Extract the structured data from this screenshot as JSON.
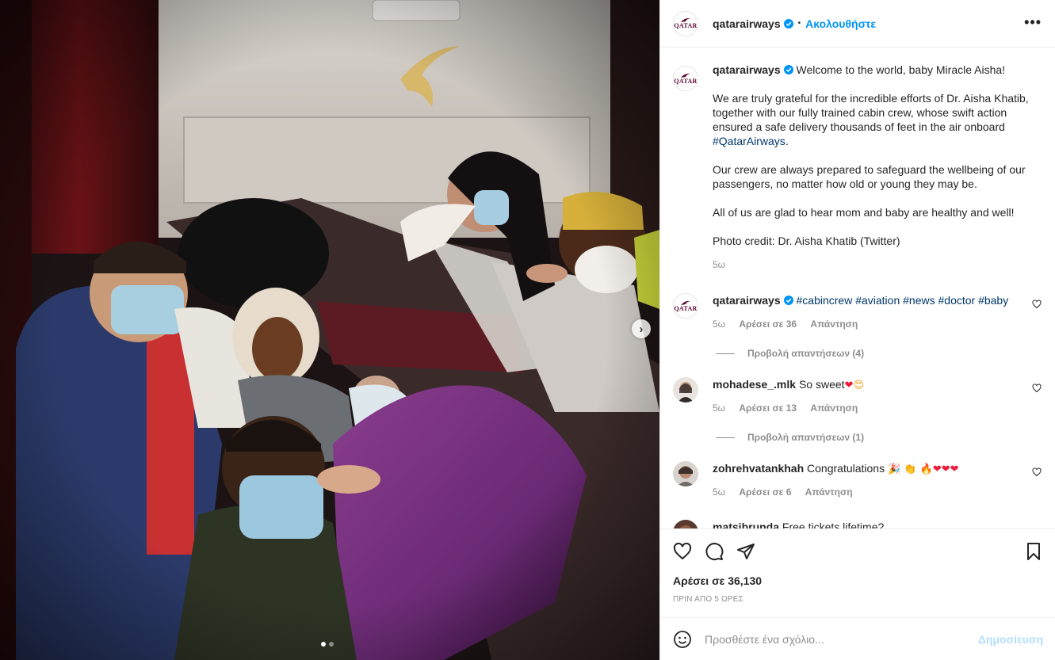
{
  "post": {
    "username": "qatarairways",
    "follow_label": "Ακολουθήστε",
    "dot_separator": "•",
    "more_label": "•••",
    "logo_text": "QATAR",
    "caption": {
      "intro": "Welcome to the world, baby Miracle Aisha!",
      "para1": "We are truly grateful for the incredible efforts of Dr. Aisha Khatib, together with our fully trained cabin crew, whose swift action ensured a safe delivery thousands of feet in the air onboard",
      "para1_tag": "#QatarAirways",
      "para1_end": ".",
      "para2": "Our crew are always prepared to safeguard the wellbeing of our passengers, no matter how old or young they may be.",
      "para3": "All of us are glad to hear mom and baby are healthy and well!",
      "para4": "Photo credit: Dr. Aisha Khatib (Twitter)",
      "age": "5ω"
    },
    "comments": [
      {
        "username": "qatarairways",
        "text": "#cabincrew #aviation #news #doctor #baby",
        "age": "5ω",
        "likes": "Αρέσει σε 36",
        "reply": "Απάντηση",
        "view_replies": "Προβολή απαντήσεων (4)"
      },
      {
        "username": "mohadese_.mlk",
        "text": "So sweet",
        "emoji": "❤",
        "emoji2": "😍",
        "age": "5ω",
        "likes": "Αρέσει σε 13",
        "reply": "Απάντηση",
        "view_replies": "Προβολή απαντήσεων (1)"
      },
      {
        "username": "zohrehvatankhah",
        "text": "Congratulations",
        "emoji": "🎉 👏 🔥",
        "emoji_hearts": "❤❤❤",
        "age": "5ω",
        "likes": "Αρέσει σε 6",
        "reply": "Απάντηση"
      },
      {
        "username": "matsibrunda",
        "text": "Free tickets lifetime?"
      }
    ],
    "likes_label": "Αρέσει σε 36,130",
    "time_label": "ΠΡΙΝ ΑΠΟ 5 ΩΡΕΣ",
    "add_comment_placeholder": "Προσθέστε ένα σχόλιο...",
    "publish_label": "Δημοσίευση",
    "next_arrow": "›",
    "carousel": {
      "count": 2,
      "active": 1
    }
  },
  "colors": {
    "link_blue": "#0095f6",
    "hashtag": "#00376b",
    "muted": "#8e8e8e",
    "publish_disabled": "#b2dffc",
    "qatar_maroon": "#5c0632"
  },
  "icons": {
    "verified": "verified-badge-icon",
    "like": "heart-icon",
    "comment": "comment-bubble-icon",
    "share": "paper-plane-icon",
    "save": "bookmark-icon",
    "emoji": "smiley-icon",
    "next": "chevron-right-icon"
  }
}
